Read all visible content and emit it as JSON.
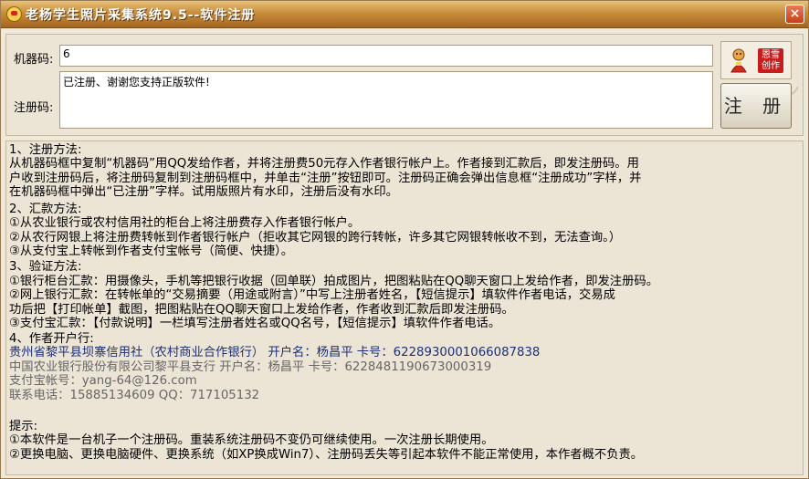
{
  "window": {
    "title": "老杨学生照片采集系统9.5--软件注册",
    "close_label": "×"
  },
  "form": {
    "machine_code_label": "机器码:",
    "machine_code_value": "6",
    "reg_code_label": "注册码:",
    "reg_code_value": "已注册、谢谢您支持正版软件!",
    "register_button": "注 册",
    "seal_text": "恩雪创作"
  },
  "info": {
    "lines": [
      {
        "text": "  1、注册方法:",
        "style": "normal"
      },
      {
        "text": "  从机器码框中复制“机器码”用QQ发给作者，并将注册费50元存入作者银行帐户上。作者接到汇款后，即发注册码。用",
        "style": "normal"
      },
      {
        "text": "户收到注册码后，将注册码复制到注册码框中，并单击“注册”按钮即可。注册码正确会弹出信息框“注册成功”字样，并",
        "style": "normal"
      },
      {
        "text": "在机器码框中弹出“已注册”字样。试用版照片有水印，注册后没有水印。",
        "style": "normal"
      },
      {
        "text": "  2、汇款方法:",
        "style": "normal"
      },
      {
        "text": "  ①从农业银行或农村信用社的柜台上将注册费存入作者银行帐户。",
        "style": "normal"
      },
      {
        "text": "  ②从农行网银上将注册费转帐到作者银行帐户（拒收其它网银的跨行转帐，许多其它网银转帐收不到，无法查询。）",
        "style": "normal"
      },
      {
        "text": "  ③从支付宝上转帐到作者支付宝帐号（简便、快捷）。",
        "style": "normal"
      },
      {
        "text": "  3、验证方法:",
        "style": "normal"
      },
      {
        "text": "  ①银行柜台汇款：用摄像头，手机等把银行收据（回单联）拍成图片，把图粘贴在QQ聊天窗口上发给作者，即发注册码。",
        "style": "normal"
      },
      {
        "text": "  ②网上银行汇款：在转帐单的“交易摘要（用途或附言）”中写上注册者姓名，【短信提示】填软件作者电话，交易成",
        "style": "normal"
      },
      {
        "text": "功后把【打印帐单】截图，把图粘贴在QQ聊天窗口上发给作者，作者收到汇款后即发注册码。",
        "style": "normal"
      },
      {
        "text": "  ③支付宝汇款：【付款说明】一栏填写注册者姓名或QQ名号，【短信提示】填软件作者电话。",
        "style": "normal"
      },
      {
        "text": "  4、作者开户行:",
        "style": "normal"
      },
      {
        "text": "  贵州省黎平县坝寨信用社（农村商业合作银行）  开户名：杨昌平  卡号：6228930001066087838",
        "style": "blue"
      },
      {
        "text": "  中国农业银行股份有限公司黎平县支行          开户名：杨昌平  卡号：6228481190673000319",
        "style": "gray"
      },
      {
        "text": "  支付宝帐号：yang-64@126.com",
        "style": "gray"
      },
      {
        "text": "  联系电话：15885134609      QQ：717105132",
        "style": "gray"
      },
      {
        "text": "",
        "style": "normal"
      },
      {
        "text": "提示:",
        "style": "normal"
      },
      {
        "text": "①本软件是一台机子一个注册码。重装系统注册码不变仍可继续使用。一次注册长期使用。",
        "style": "normal"
      },
      {
        "text": "②更换电脑、更换电脑硬件、更换系统（如XP换成Win7）、注册码丢失等引起本软件不能正常使用，本作者概不负责。",
        "style": "normal"
      }
    ]
  }
}
